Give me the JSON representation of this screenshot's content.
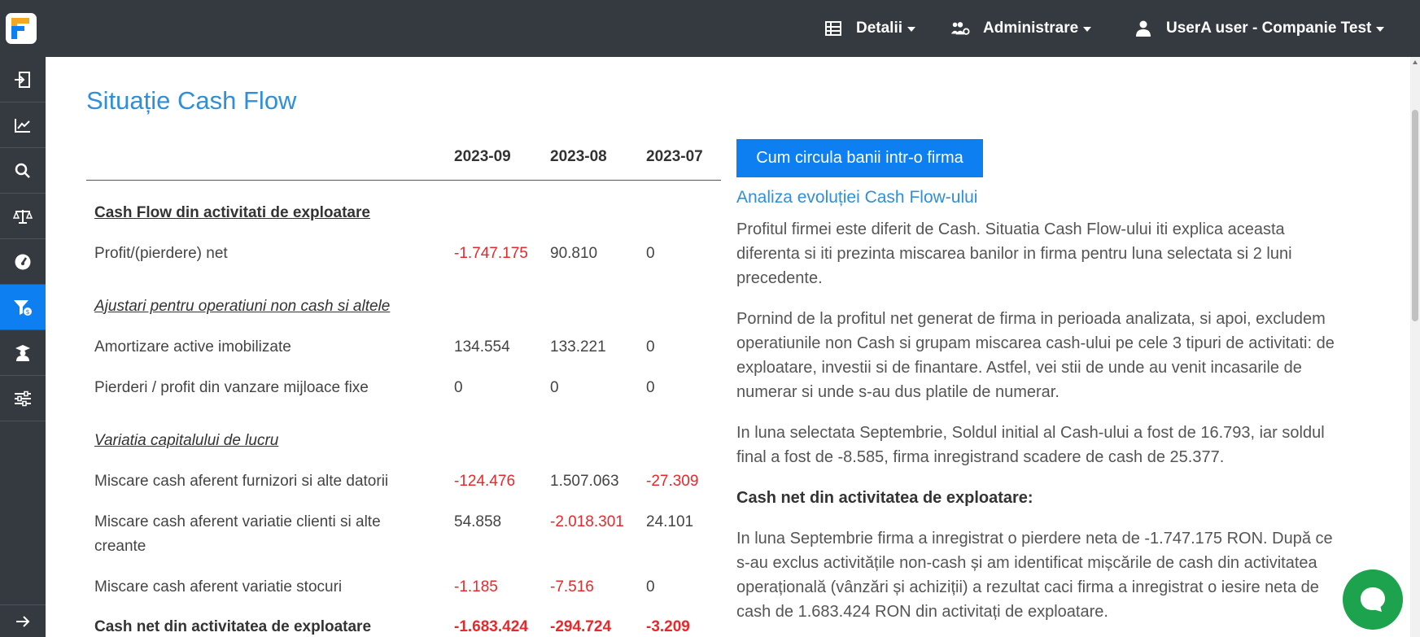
{
  "brand": {
    "logo_letter": "F",
    "colors": {
      "dark": "#343a40",
      "accent": "#0d7ff0",
      "negative": "#e8282b",
      "title": "#2f8fd8",
      "chat": "#1da34d"
    }
  },
  "nav": {
    "details": {
      "label": "Detalii",
      "icon": "table-icon"
    },
    "admin": {
      "label": "Administrare",
      "icon": "users-cog-icon"
    },
    "user": {
      "label": "UserA user - Companie Test",
      "icon": "user-icon"
    }
  },
  "sidebar": {
    "items": [
      {
        "icon": "sign-in-file-icon"
      },
      {
        "icon": "line-chart-icon"
      },
      {
        "icon": "search-icon"
      },
      {
        "icon": "balance-scale-icon"
      },
      {
        "icon": "dashboard-gauge-icon"
      },
      {
        "icon": "cash-flow-filter-icon",
        "active": true
      },
      {
        "icon": "graduation-icon"
      },
      {
        "icon": "sliders-icon"
      }
    ],
    "bottom_icon": "expand-arrow-icon"
  },
  "page": {
    "title": "Situație Cash Flow"
  },
  "table": {
    "columns": [
      "2023-09",
      "2023-08",
      "2023-07"
    ],
    "rows": {
      "sec1": "Cash Flow din activitati de exploatare",
      "profit": {
        "label": "Profit/(pierdere) net",
        "v": [
          "-1.747.175",
          "90.810",
          "0"
        ]
      },
      "sec2": "Ajustari pentru operatiuni non cash si altele",
      "amort": {
        "label": "Amortizare active imobilizate",
        "v": [
          "134.554",
          "133.221",
          "0"
        ]
      },
      "pierderi": {
        "label": "Pierderi / profit din vanzare mijloace fixe",
        "v": [
          "0",
          "0",
          "0"
        ]
      },
      "sec3": "Variatia capitalului de lucru",
      "furnizori": {
        "label": "Miscare cash aferent furnizori si alte datorii",
        "v": [
          "-124.476",
          "1.507.063",
          "-27.309"
        ]
      },
      "clienti": {
        "label_l1": "Miscare cash aferent variatie clienti si alte",
        "label_l2": "creante",
        "v": [
          "54.858",
          "-2.018.301",
          "24.101"
        ]
      },
      "stocuri": {
        "label": "Miscare cash aferent variatie stocuri",
        "v": [
          "-1.185",
          "-7.516",
          "0"
        ]
      },
      "total": {
        "label": "Cash net din activitatea de exploatare",
        "v": [
          "-1.683.424",
          "-294.724",
          "-3.209"
        ]
      }
    }
  },
  "panel": {
    "cta": "Cum circula banii intr-o firma",
    "link": "Analiza evoluției Cash Flow-ului",
    "p1": [
      "Profitul firmei este diferit de Cash. Situatia Cash Flow-ului iti explica aceasta",
      "diferenta si iti prezinta miscarea banilor in firma pentru luna selectata si 2 luni",
      "precedente."
    ],
    "p2": [
      "Pornind de la profitul net generat de firma in perioada analizata, si apoi, excludem",
      "operatiunile non Cash si grupam miscarea cash-ului pe cele 3 tipuri de activitati: de",
      "exploatare, investii si de finantare. Astfel, vei stii de unde au venit incasarile de",
      "numerar si unde s-au dus platile de numerar."
    ],
    "p3": [
      "In luna selectata Septembrie, Soldul initial al Cash-ului a fost de 16.793, iar soldul",
      "final a fost de -8.585, firma inregistrand scadere de cash de 25.377."
    ],
    "h1": "Cash net din activitatea de exploatare:",
    "p4": [
      "In luna Septembrie firma a inregistrat o pierdere neta de -1.747.175 RON. După ce",
      "s-au exclus activitățile non-cash și am identificat mișcările de cash din activitatea",
      "operațională (vânzări și achiziții) a rezultat caci firma a inregistrat o iesire neta de",
      "cash de 1.683.424 RON din activitați de exploatare."
    ]
  },
  "chat": {
    "icon": "chat-bubble-icon"
  }
}
